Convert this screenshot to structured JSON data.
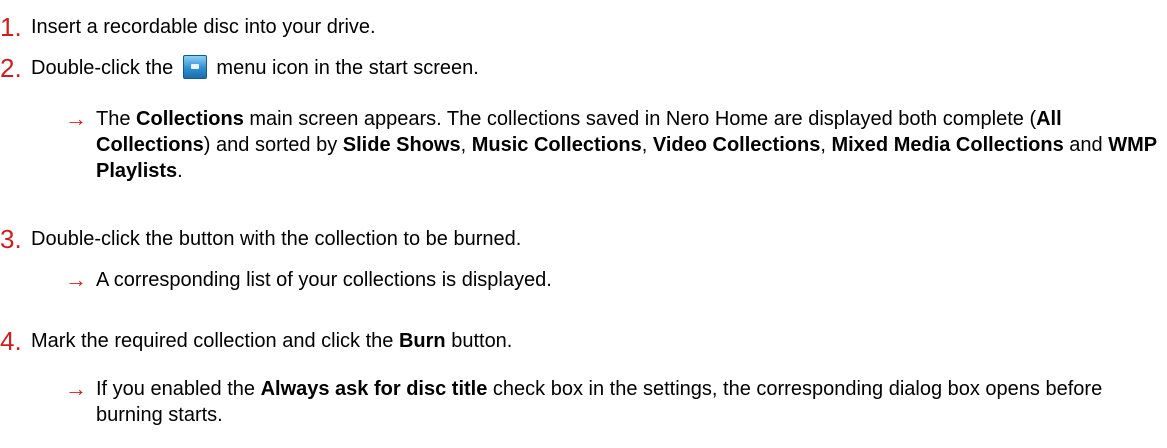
{
  "steps": [
    {
      "number": "1.",
      "text": "Insert a recordable disc into your drive."
    },
    {
      "number": "2.",
      "before_icon": "Double-click the",
      "icon": "collections-icon",
      "after_icon": "menu icon in the start screen."
    },
    {
      "number": "3.",
      "text": "Double-click the button with the collection to be burned."
    },
    {
      "number": "4.",
      "before_bold": "Mark the required collection and click the",
      "bold": "Burn",
      "after_bold": "button."
    }
  ],
  "results": {
    "r2": {
      "arrow": "→",
      "t1": "The",
      "b1": "Collections",
      "t2": "main screen appears. The collections saved in Nero Home are displayed both complete (",
      "b2": "All Collections",
      "t3": ") and sorted by",
      "b3": "Slide Shows",
      "t4": ",",
      "b4": "Music Collections",
      "t5": ",",
      "b5": "Video Collections",
      "t6": ",",
      "b6": "Mixed Media Collections",
      "t7": "and",
      "b7": "WMP Playlists",
      "t8": "."
    },
    "r3": {
      "arrow": "→",
      "text": "A corresponding list of your collections is displayed."
    },
    "r4": {
      "arrow": "→",
      "t1": "If you enabled the",
      "b1": "Always ask for disc title",
      "t2": "check box in the settings, the corresponding dialog box opens before burning starts."
    }
  }
}
